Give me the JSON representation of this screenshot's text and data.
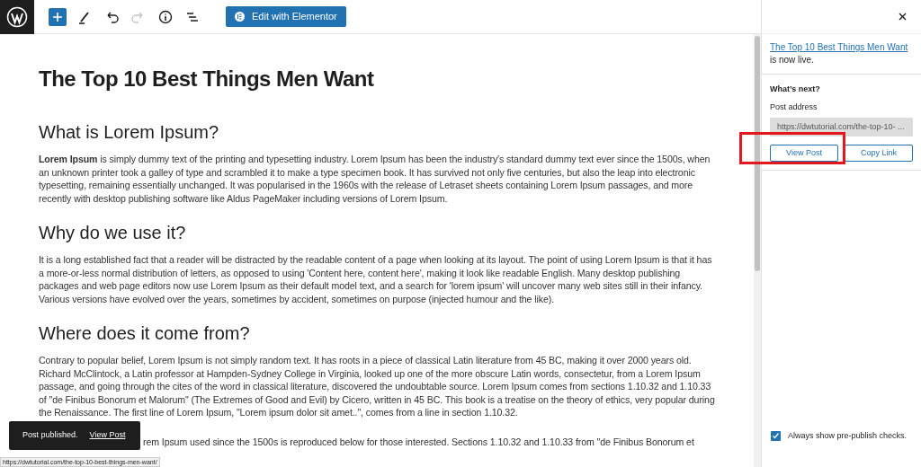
{
  "toolbar": {
    "tools": [
      {
        "kind": "add",
        "disabled": false
      },
      {
        "kind": "edit",
        "disabled": false
      },
      {
        "kind": "undo",
        "disabled": false
      },
      {
        "kind": "redo",
        "disabled": true
      },
      {
        "kind": "info",
        "disabled": false
      },
      {
        "kind": "outline",
        "disabled": false
      }
    ],
    "elementor_button": "Edit with Elementor"
  },
  "editor": {
    "title": "The Top 10 Best Things Men Want",
    "blocks": [
      {
        "kind": "heading",
        "text": "What is Lorem Ipsum?"
      },
      {
        "kind": "paragraph",
        "text": "**Lorem Ipsum** is simply dummy text of the printing and typesetting industry. Lorem Ipsum has been the industry's standard dummy text ever since the 1500s, when an unknown printer took a galley of type and scrambled it to make a type specimen book. It has survived not only five centuries, but also the leap into electronic typesetting, remaining essentially unchanged. It was popularised in the 1960s with the release of Letraset sheets containing Lorem Ipsum passages, and more recently with desktop publishing software like Aldus PageMaker including versions of Lorem Ipsum."
      },
      {
        "kind": "heading",
        "text": "Why do we use it?"
      },
      {
        "kind": "paragraph",
        "text": "It is a long established fact that a reader will be distracted by the readable content of a page when looking at its layout. The point of using Lorem Ipsum is that it has a more-or-less normal distribution of letters, as opposed to using 'Content here, content here', making it look like readable English. Many desktop publishing packages and web page editors now use Lorem Ipsum as their default model text, and a search for 'lorem ipsum' will uncover many web sites still in their infancy. Various versions have evolved over the years, sometimes by accident, sometimes on purpose (injected humour and the like)."
      },
      {
        "kind": "heading",
        "text": "Where does it come from?"
      },
      {
        "kind": "paragraph",
        "text": "Contrary to popular belief, Lorem Ipsum is not simply random text. It has roots in a piece of classical Latin literature from 45 BC, making it over 2000 years old. Richard McClintock, a Latin professor at Hampden-Sydney College in Virginia, looked up one of the more obscure Latin words, consectetur, from a Lorem Ipsum passage, and going through the cites of the word in classical literature, discovered the undoubtable source. Lorem Ipsum comes from sections 1.10.32 and 1.10.33 of \"de Finibus Bonorum et Malorum\" (The Extremes of Good and Evil) by Cicero, written in 45 BC. This book is a treatise on the theory of ethics, very popular during the Renaissance. The first line of Lorem Ipsum, \"Lorem ipsum dolor sit amet..\", comes from a line in section 1.10.32."
      },
      {
        "kind": "partial",
        "text": "rem Ipsum used since the 1500s is reproduced below for those interested. Sections 1.10.32 and 1.10.33 from \"de Finibus Bonorum et"
      }
    ]
  },
  "snackbar": {
    "message": "Post published.",
    "action": "View Post"
  },
  "status_url": "https://dwtutorial.com/the-top-10-best-things-men-want/",
  "sidebar": {
    "notice_link": "The Top 10 Best Things Men Want",
    "notice_text": " is now live.",
    "whats_next": "What’s next?",
    "address_label": "Post address",
    "address": "https://dwtutorial.com/the-top-10- ...",
    "buttons": [
      "View Post",
      "Copy Link"
    ],
    "prepublish": {
      "label": "Always show pre-publish checks.",
      "checked": true
    }
  }
}
